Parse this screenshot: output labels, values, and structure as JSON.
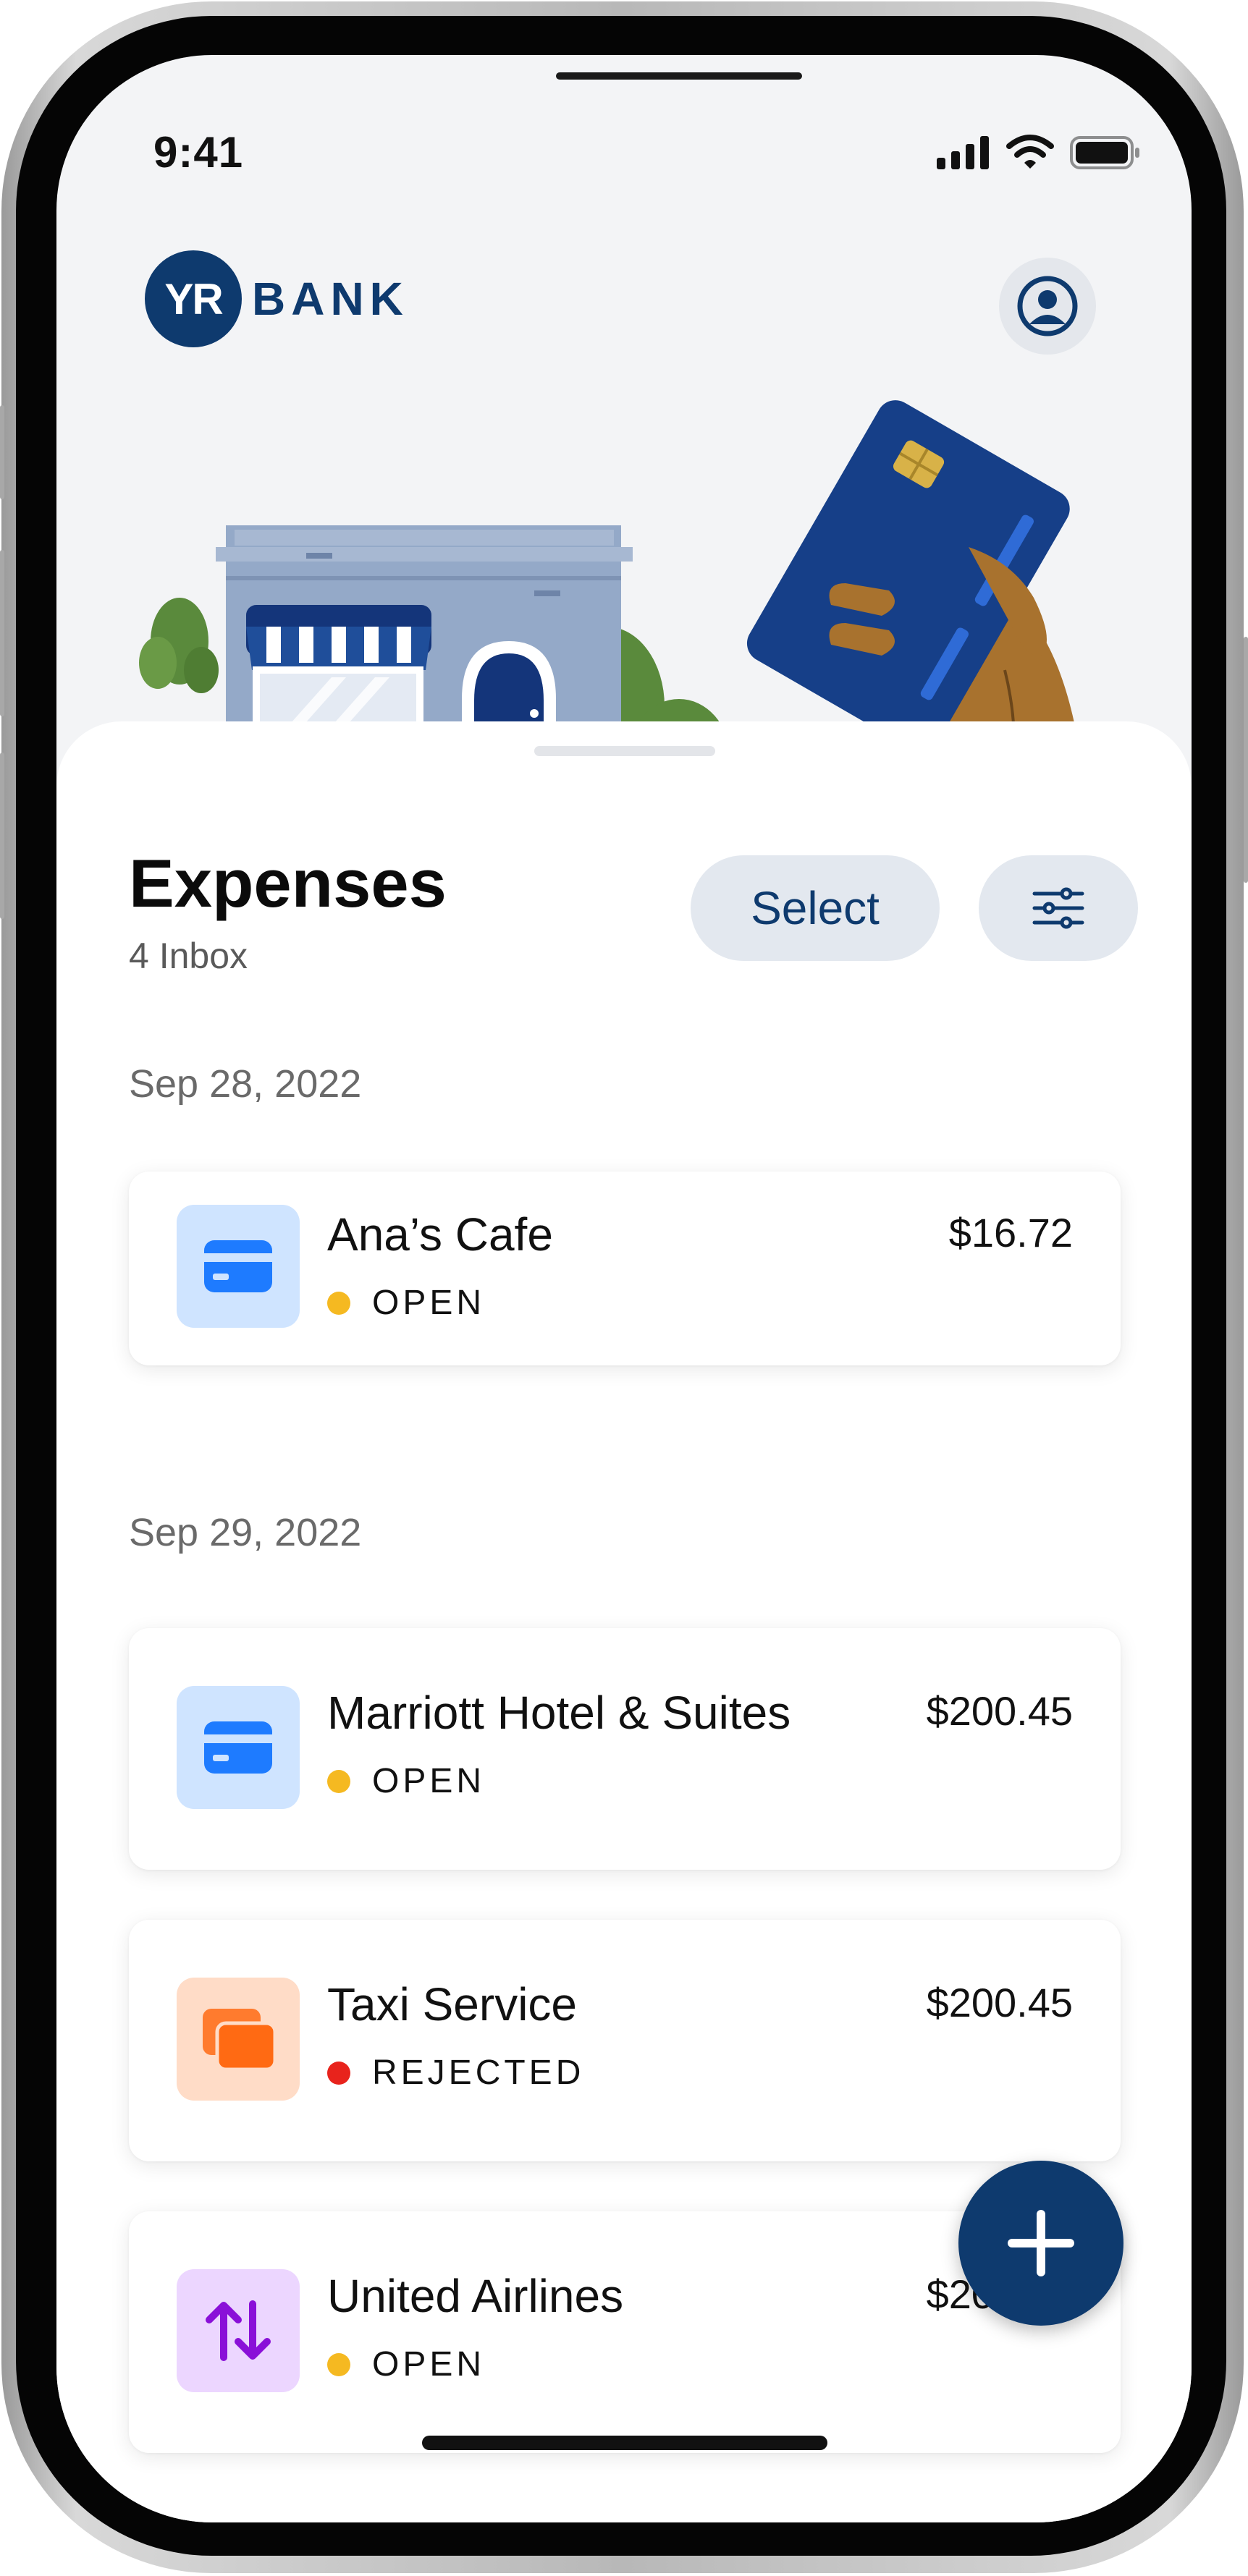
{
  "status_bar": {
    "time": "9:41"
  },
  "header": {
    "logo_mark": "YR",
    "logo_word": "BANK"
  },
  "expenses": {
    "title": "Expenses",
    "subtitle": "4 Inbox",
    "select_label": "Select",
    "groups": [
      {
        "date": "Sep 28, 2022",
        "items": [
          {
            "merchant": "Ana’s Cafe",
            "amount": "$16.72",
            "status": "OPEN",
            "icon": "credit-card-icon"
          }
        ]
      },
      {
        "date": "Sep 29, 2022",
        "items": [
          {
            "merchant": "Marriott Hotel & Suites",
            "amount": "$200.45",
            "status": "OPEN",
            "icon": "credit-card-icon"
          },
          {
            "merchant": "Taxi Service",
            "amount": "$200.45",
            "status": "REJECTED",
            "icon": "cards-stack-icon"
          },
          {
            "merchant": "United Airlines",
            "amount": "$200.45",
            "status": "OPEN",
            "icon": "transfer-arrows-icon"
          }
        ]
      }
    ]
  },
  "colors": {
    "brand": "#0e3a6e",
    "open": "#f5b921",
    "rejected": "#e8231c",
    "card_icon_bg": "#cfe4ff",
    "card_icon_fg": "#1e7bff",
    "stack_icon_bg": "#ffdcc7",
    "stack_icon_fg": "#ff6a13",
    "transfer_icon_bg": "#ecd6ff",
    "transfer_icon_fg": "#8a10d8"
  }
}
